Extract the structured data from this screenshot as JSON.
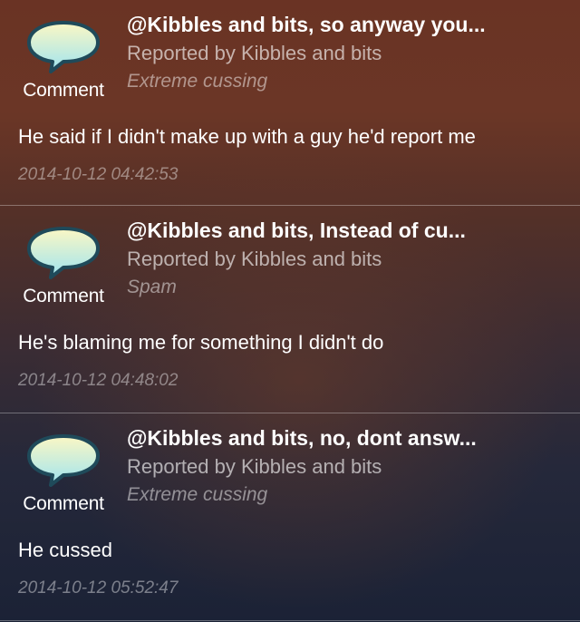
{
  "reports": [
    {
      "icon_label": "Comment",
      "title": "@Kibbles and bits, so anyway you...",
      "reporter": "Reported by Kibbles and bits",
      "reason": "Extreme cussing",
      "message": "He said if I didn't make up with a guy he'd report me",
      "timestamp": "2014-10-12 04:42:53"
    },
    {
      "icon_label": "Comment",
      "title": "@Kibbles and bits, Instead of cu...",
      "reporter": "Reported by Kibbles and bits",
      "reason": "Spam",
      "message": "He's blaming me for something I didn't do",
      "timestamp": "2014-10-12 04:48:02"
    },
    {
      "icon_label": "Comment",
      "title": "@Kibbles and bits, no, dont answ...",
      "reporter": "Reported by Kibbles and bits",
      "reason": "Extreme cussing",
      "message": "He cussed",
      "timestamp": "2014-10-12 05:52:47"
    }
  ],
  "icons": {
    "comment": "speech-bubble-icon"
  },
  "colors": {
    "bubble_top": "#fbf7c4",
    "bubble_bottom": "#9fe4f0",
    "bubble_outline": "#1f4a5a"
  }
}
